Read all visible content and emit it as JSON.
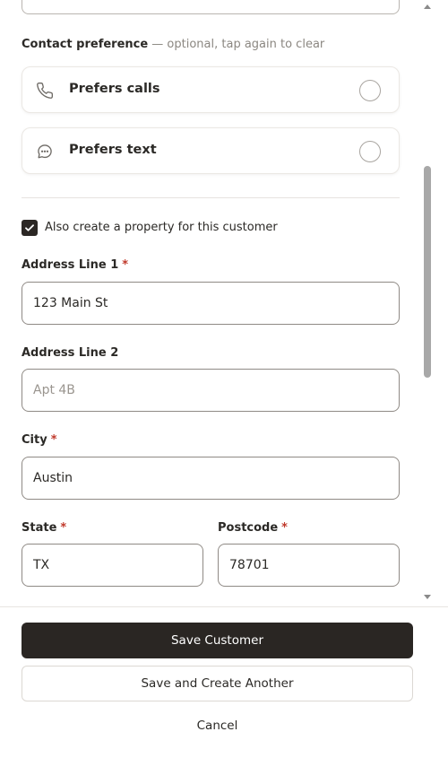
{
  "contact_preference": {
    "title": "Contact preference",
    "hint": " — optional, tap again to clear",
    "options": [
      {
        "label": "Prefers calls",
        "icon": "phone-icon",
        "selected": false
      },
      {
        "label": "Prefers text",
        "icon": "chat-bubble-icon",
        "selected": false
      }
    ]
  },
  "create_property": {
    "label": "Also create a property for this customer",
    "checked": true
  },
  "address": {
    "line1": {
      "label": "Address Line 1",
      "required_mark": "*",
      "value": "123 Main St",
      "placeholder": ""
    },
    "line2": {
      "label": "Address Line 2",
      "value": "",
      "placeholder": "Apt 4B"
    },
    "city": {
      "label": "City",
      "required_mark": "*",
      "value": "Austin"
    },
    "state": {
      "label": "State",
      "required_mark": "*",
      "value": "TX"
    },
    "postcode": {
      "label": "Postcode",
      "required_mark": "*",
      "value": "78701"
    }
  },
  "footer": {
    "save_label": "Save Customer",
    "save_another_label": "Save and Create Another",
    "cancel_label": "Cancel"
  },
  "colors": {
    "primary_button": "#2a2623",
    "required": "#c0392b",
    "checkbox": "#2b2724"
  }
}
